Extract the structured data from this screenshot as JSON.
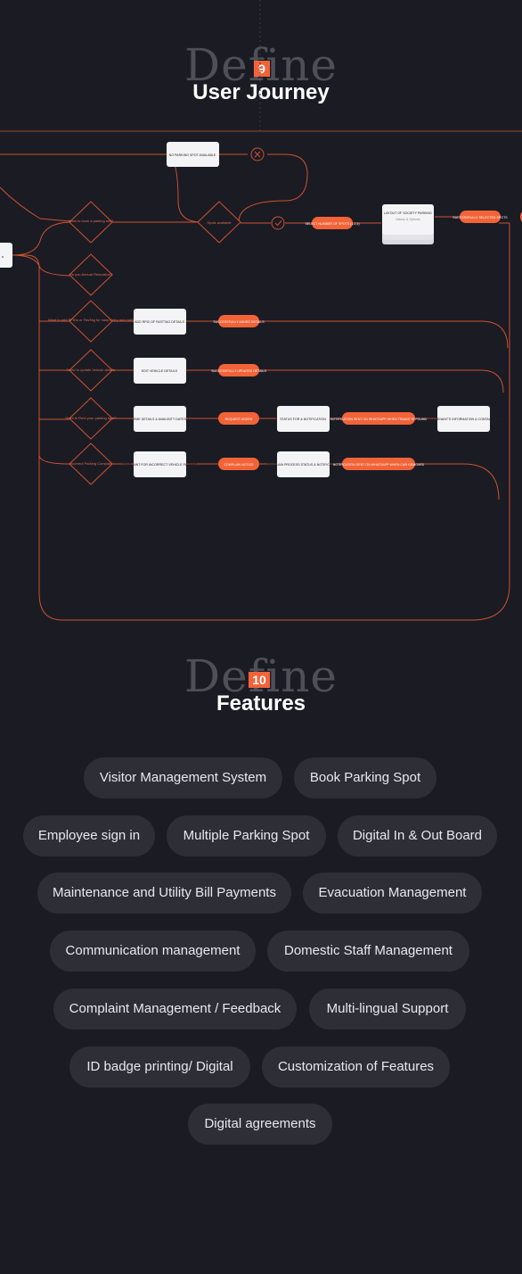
{
  "sections": [
    {
      "watermark": "Define",
      "number": "9",
      "title": "User Journey"
    },
    {
      "watermark": "Define",
      "number": "10",
      "title": "Features"
    }
  ],
  "journey": {
    "decisions": {
      "book": "Want to book a parking slot?",
      "spots": "Spots available",
      "relocation": "Do you Annual Relocation?",
      "addrfid": "Want to add RFIDs or FasTag for easy Entry and exit?",
      "vehicle": "Need to update Vehicle details",
      "rent": "Want to Rent your parking spot?",
      "incorrect": "Incorrect Parking Complain"
    },
    "process": {
      "no_spot": "NO PARKING SPOT AVAILABLE",
      "layout_title": "LAYOUT OF SOCIETY PARKING",
      "layout_sub": "Videos & Options",
      "add_rfid": "ADD RFID OF FASTTAG DETAILS",
      "edit_vehicle": "EDIT VEHICLE DETAILS",
      "time_details": "TIME DETAILS & AVAILIBITY DATES",
      "status_notif": "STATUS FOR & NOTIFICATION",
      "tenant_info": "STATUS & TENANT'S INFORMATION & CONTACT DETAILS",
      "complaint": "COMPLAINT FOR INCORRECT VEHICLE PARKING",
      "complain_process": "COMPLAIN PROCESS STATUS & NOTIFICATION"
    },
    "tags": {
      "select_spots": "SELECT NUMBER OF SPOTS (1,2,3)",
      "selected": "SUCCESSFULLY SELECTED SPOTS",
      "added": "SUCCESSFULLY ADDED DETAILS",
      "updated": "SUCCESSFULLY UPDATED DETAILS",
      "request_added": "REQUEST ADDED",
      "whatsapp_tenant": "NOTIFICATION SENT ON WHATSAPP WHEN TENANT IS FOUND",
      "complain_notice": "COMPLAIN NOTICE",
      "whatsapp_removed": "NOTIFICATION SENT ON WHATSAPP WHEN CAR REMOVED"
    },
    "start_label": "s"
  },
  "features": [
    [
      "Visitor Management System",
      "Book Parking Spot"
    ],
    [
      "Employee sign in",
      "Multiple Parking Spot",
      "Digital In & Out Board"
    ],
    [
      "Maintenance and Utility Bill Payments",
      "Evacuation Management"
    ],
    [
      "Communication management",
      "Domestic Staff Management"
    ],
    [
      "Complaint Management / Feedback",
      "Multi-lingual Support"
    ],
    [
      "ID badge printing/ Digital",
      "Customization of Features"
    ],
    [
      "Digital agreements"
    ]
  ],
  "colors": {
    "background": "#1b1b24",
    "accent": "#f26338",
    "pill": "#2e2e37",
    "node": "#f4f4f6"
  }
}
